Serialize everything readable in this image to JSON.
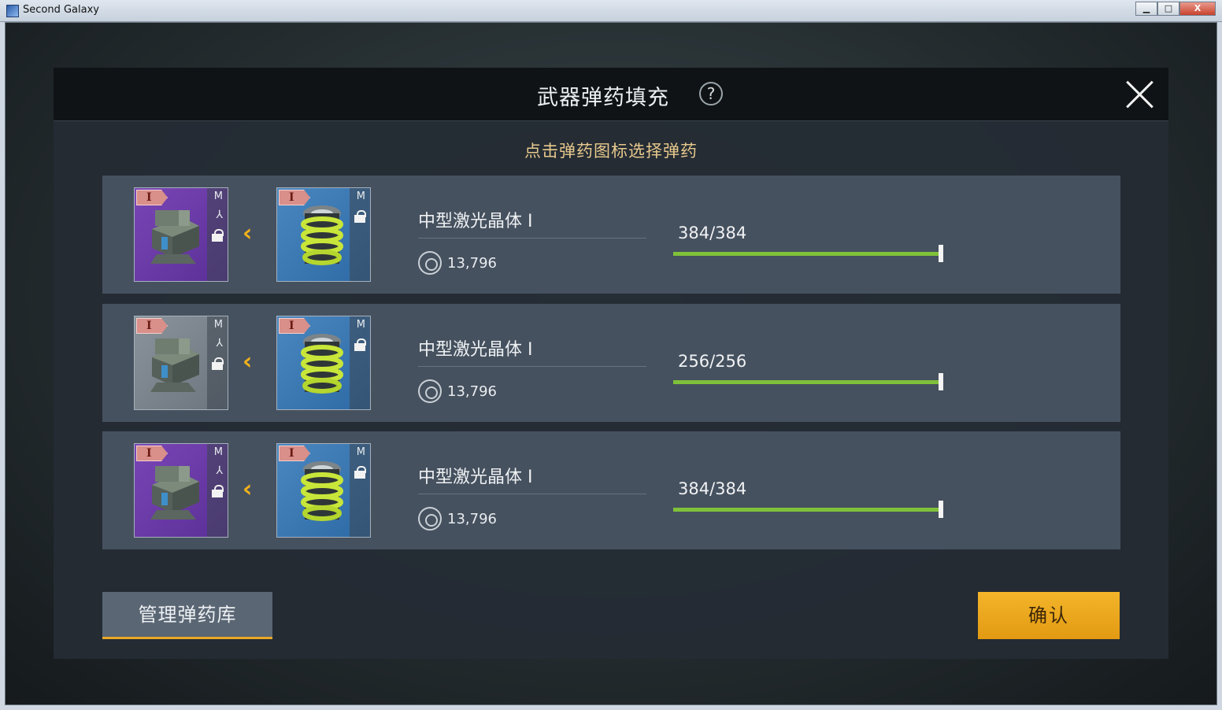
{
  "window": {
    "title": "Second Galaxy",
    "min_label": "▁",
    "max_label": "□",
    "close_label": "X"
  },
  "dialog": {
    "title": "武器弹药填充",
    "help_label": "?",
    "hint": "点击弹药图标选择弹药",
    "manage_button": "管理弹药库",
    "confirm_button": "确认"
  },
  "rows": [
    {
      "weapon_tier": "I",
      "weapon_size": "M",
      "weapon_color": "purple",
      "ammo_tier": "I",
      "ammo_size": "M",
      "arrow": "‹",
      "ammo_name": "中型激光晶体 I",
      "price": "13,796",
      "count": "384/384",
      "fill_fraction": 1.0
    },
    {
      "weapon_tier": "I",
      "weapon_size": "M",
      "weapon_color": "gray",
      "ammo_tier": "I",
      "ammo_size": "M",
      "arrow": "‹",
      "ammo_name": "中型激光晶体 I",
      "price": "13,796",
      "count": "256/256",
      "fill_fraction": 1.0
    },
    {
      "weapon_tier": "I",
      "weapon_size": "M",
      "weapon_color": "purple",
      "ammo_tier": "I",
      "ammo_size": "M",
      "arrow": "‹",
      "ammo_name": "中型激光晶体 I",
      "price": "13,796",
      "count": "384/384",
      "fill_fraction": 1.0
    }
  ],
  "colors": {
    "accent": "#f2b21b",
    "bar": "#7fc23a",
    "hint": "#e8c98d"
  },
  "icons": {
    "help": "help-icon",
    "close": "close-icon",
    "lock": "lock-icon",
    "currency": "coin-icon",
    "swap": "chevron-left-icon"
  }
}
